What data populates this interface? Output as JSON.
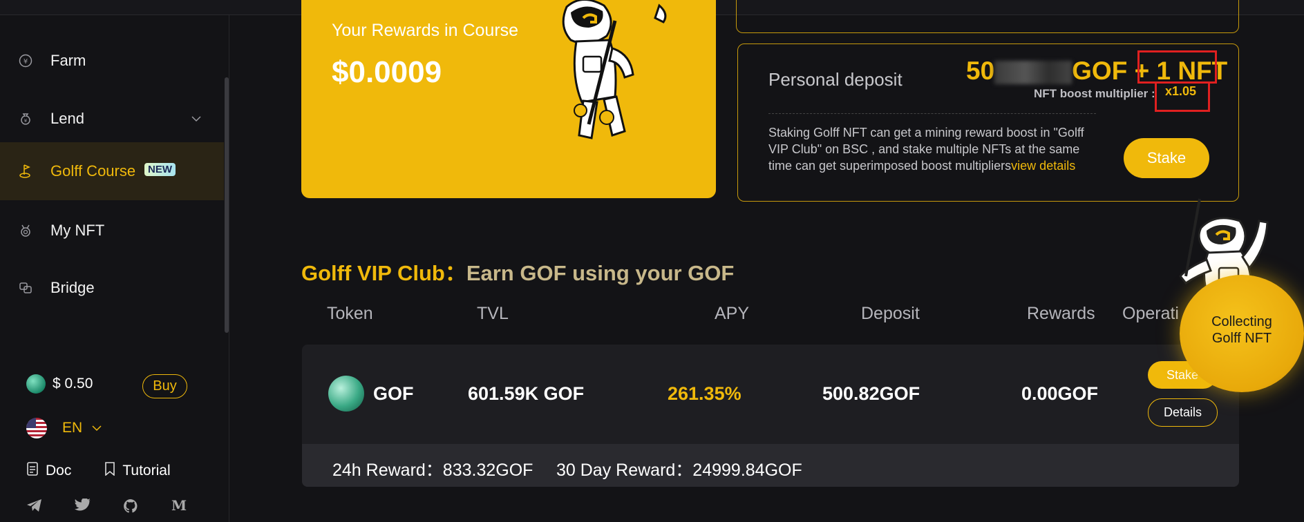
{
  "sidebar": {
    "items": [
      {
        "label": "Farm",
        "icon": "yen-coin-icon"
      },
      {
        "label": "Lend",
        "icon": "money-bag-icon"
      },
      {
        "label": "Golff Course",
        "icon": "golf-flag-icon",
        "badge": "NEW"
      },
      {
        "label": "My NFT",
        "icon": "medal-icon"
      },
      {
        "label": "Bridge",
        "icon": "bridge-icon"
      }
    ],
    "price": "$ 0.50",
    "buy_label": "Buy",
    "language": "EN",
    "doc_label": "Doc",
    "tutorial_label": "Tutorial",
    "social": [
      "telegram-icon",
      "twitter-icon",
      "github-icon",
      "medium-icon"
    ]
  },
  "rewards": {
    "title": "Your Rewards in Course",
    "value": "$0.0009"
  },
  "deposit": {
    "label": "Personal deposit",
    "amount_prefix": "50",
    "amount_suffix": "GOF + 1 NFT",
    "boost_label": "NFT boost multiplier :",
    "boost_value": "x1.05",
    "description": "Staking Golff NFT can get a mining reward boost in \"Golff VIP Club\" on BSC , and stake multiple NFTs at the same time can get superimposed boost multipliers",
    "link": "view details",
    "stake_label": "Stake"
  },
  "club": {
    "title": "Golff VIP Club：",
    "subtitle": "Earn GOF using your GOF",
    "headers": [
      "Token",
      "TVL",
      "APY",
      "Deposit",
      "Rewards",
      "Operati"
    ],
    "row": {
      "token": "GOF",
      "tvl": "601.59K GOF",
      "apy": "261.35%",
      "deposit": "500.82GOF",
      "rewards": "0.00GOF",
      "stake_label": "Stake",
      "details_label": "Details",
      "reward_24h": "24h Reward：833.32GOF",
      "reward_30d": "30 Day Reward：24999.84GOF"
    }
  },
  "collect": {
    "line1": "Collecting",
    "line2": "Golff NFT"
  },
  "colors": {
    "accent": "#f0b90b",
    "background": "#131316",
    "highlight": "#e02020"
  }
}
